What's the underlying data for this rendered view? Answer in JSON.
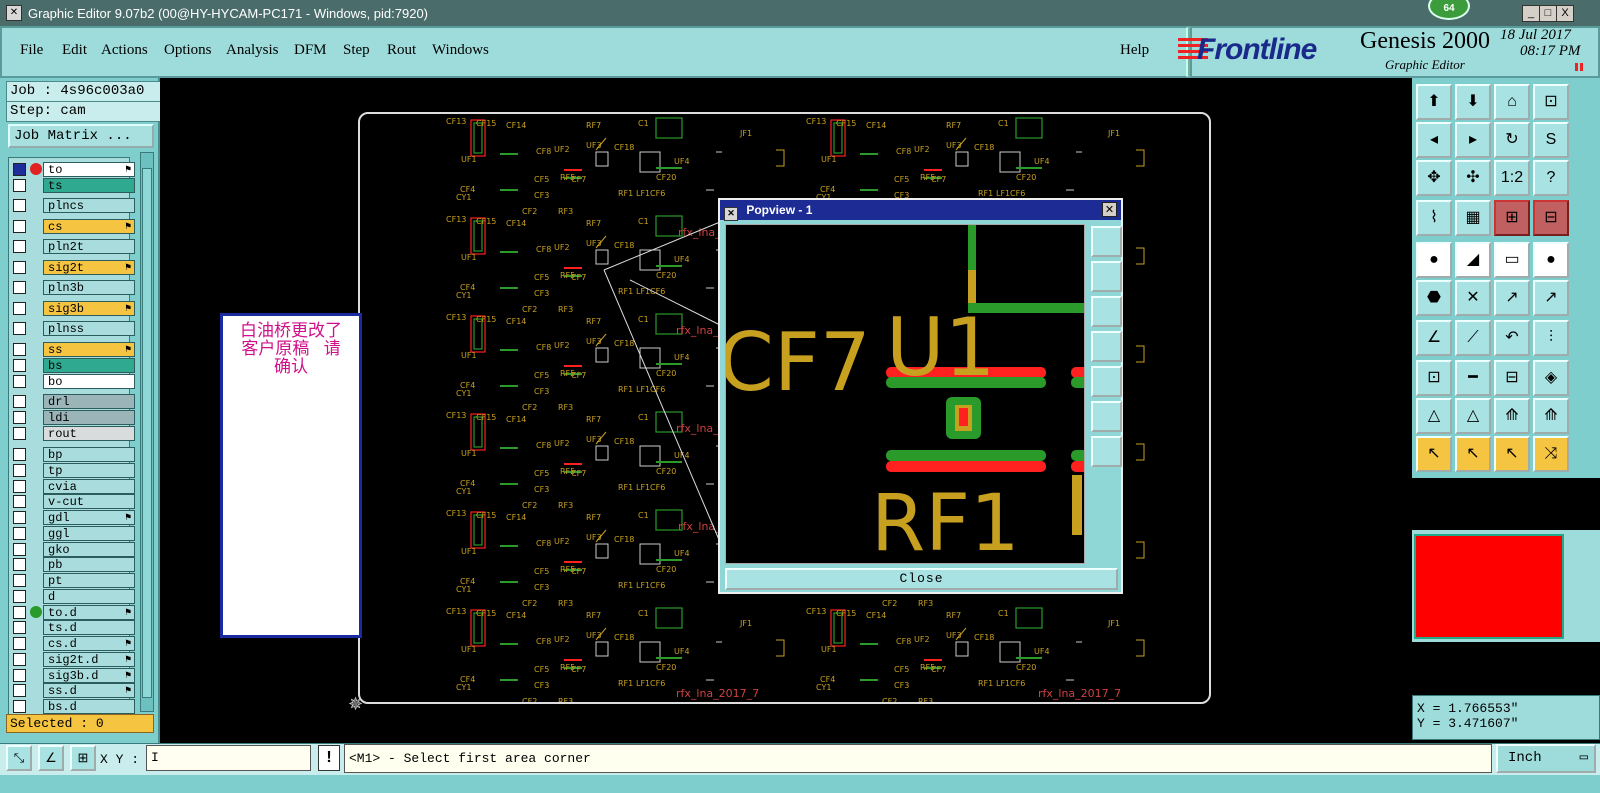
{
  "window": {
    "title": "Graphic Editor 9.07b2 (00@HY-HYCAM-PC171 - Windows, pid:7920)",
    "badge": "64",
    "controls": [
      "_",
      "□",
      "X"
    ]
  },
  "menu": {
    "items": [
      "File",
      "Edit",
      "Actions",
      "Options",
      "Analysis",
      "DFM",
      "Step",
      "Rout",
      "Windows"
    ],
    "help": "Help"
  },
  "brand": {
    "logo": "Frontline",
    "product": "Genesis 2000",
    "subtitle": "Graphic Editor",
    "date": "18 Jul 2017",
    "time": "08:17 PM"
  },
  "job": {
    "job_label": "Job : 4s96c003a0",
    "step_label": "Step: cam",
    "matrix_button": "Job Matrix ..."
  },
  "layers": [
    {
      "name": "to",
      "bg": "#ffffff",
      "checked": true,
      "dot": "#e22222",
      "flag": "⚑"
    },
    {
      "name": "ts",
      "bg": "#2fa98f",
      "checked": false,
      "dot": "",
      "flag": ""
    },
    {
      "name": "plncs",
      "bg": "#a9dcdc",
      "checked": false,
      "dot": "",
      "flag": ""
    },
    {
      "name": "cs",
      "bg": "#f5c542",
      "checked": false,
      "dot": "",
      "flag": "⚑"
    },
    {
      "name": "pln2t",
      "bg": "#a9dcdc",
      "checked": false,
      "dot": "",
      "flag": ""
    },
    {
      "name": "sig2t",
      "bg": "#f5c542",
      "checked": false,
      "dot": "",
      "flag": "⚑"
    },
    {
      "name": "pln3b",
      "bg": "#a9dcdc",
      "checked": false,
      "dot": "",
      "flag": ""
    },
    {
      "name": "sig3b",
      "bg": "#f5c542",
      "checked": false,
      "dot": "",
      "flag": "⚑"
    },
    {
      "name": "plnss",
      "bg": "#a9dcdc",
      "checked": false,
      "dot": "",
      "flag": ""
    },
    {
      "name": "ss",
      "bg": "#f5c542",
      "checked": false,
      "dot": "",
      "flag": "⚑"
    },
    {
      "name": "bs",
      "bg": "#2fa98f",
      "checked": false,
      "dot": "",
      "flag": ""
    },
    {
      "name": "bo",
      "bg": "#ffffff",
      "checked": false,
      "dot": "",
      "flag": ""
    },
    {
      "name": "drl",
      "bg": "#9ab4b8",
      "checked": false,
      "dot": "",
      "flag": ""
    },
    {
      "name": "ldi",
      "bg": "#9ab4b8",
      "checked": false,
      "dot": "",
      "flag": ""
    },
    {
      "name": "rout",
      "bg": "#d8dcdc",
      "checked": false,
      "dot": "",
      "flag": ""
    },
    {
      "name": "bp",
      "bg": "#a9dcdc",
      "checked": false,
      "dot": "",
      "flag": ""
    },
    {
      "name": "tp",
      "bg": "#a9dcdc",
      "checked": false,
      "dot": "",
      "flag": ""
    },
    {
      "name": "cvia",
      "bg": "#a9dcdc",
      "checked": false,
      "dot": "",
      "flag": ""
    },
    {
      "name": "v-cut",
      "bg": "#a9dcdc",
      "checked": false,
      "dot": "",
      "flag": ""
    },
    {
      "name": "gdl",
      "bg": "#a9dcdc",
      "checked": false,
      "dot": "",
      "flag": "⚑"
    },
    {
      "name": "ggl",
      "bg": "#a9dcdc",
      "checked": false,
      "dot": "",
      "flag": ""
    },
    {
      "name": "gko",
      "bg": "#a9dcdc",
      "checked": false,
      "dot": "",
      "flag": ""
    },
    {
      "name": "pb",
      "bg": "#a9dcdc",
      "checked": false,
      "dot": "",
      "flag": ""
    },
    {
      "name": "pt",
      "bg": "#a9dcdc",
      "checked": false,
      "dot": "",
      "flag": ""
    },
    {
      "name": "d",
      "bg": "#a9dcdc",
      "checked": false,
      "dot": "",
      "flag": ""
    },
    {
      "name": "to.d",
      "bg": "#a9dcdc",
      "checked": false,
      "dot": "#2a9a2a",
      "flag": "⚑"
    },
    {
      "name": "ts.d",
      "bg": "#a9dcdc",
      "checked": false,
      "dot": "",
      "flag": ""
    },
    {
      "name": "cs.d",
      "bg": "#a9dcdc",
      "checked": false,
      "dot": "",
      "flag": "⚑"
    },
    {
      "name": "sig2t.d",
      "bg": "#a9dcdc",
      "checked": false,
      "dot": "",
      "flag": "⚑"
    },
    {
      "name": "sig3b.d",
      "bg": "#a9dcdc",
      "checked": false,
      "dot": "",
      "flag": "⚑"
    },
    {
      "name": "ss.d",
      "bg": "#a9dcdc",
      "checked": false,
      "dot": "",
      "flag": "⚑"
    },
    {
      "name": "bs.d",
      "bg": "#a9dcdc",
      "checked": false,
      "dot": "",
      "flag": ""
    }
  ],
  "selected_label": "Selected : 0",
  "note": {
    "line1": "白油桥更改了",
    "line2": "客户原稿   请",
    "line3": "确认"
  },
  "board": {
    "silk_labels": [
      "CF13",
      "CF15",
      "CF14",
      "RF7",
      "C1",
      "JF1",
      "UF1",
      "CF8",
      "UF2",
      "UF3",
      "CF5",
      "RF5",
      "CF7",
      "RF1",
      "LF1",
      "CF6",
      "CF3",
      "RF3",
      "CF4",
      "CY1",
      "CF2",
      "CF20",
      "UF4",
      "CF16",
      "CF18"
    ],
    "panel_text": "rfx_lna_2017_7"
  },
  "popview": {
    "title": "Popview - 1",
    "close_label": "Close",
    "labels": {
      "cf7": "CF7",
      "u1": "U1",
      "rf1": "RF1"
    }
  },
  "coords": {
    "x": "X = 1.766553\"",
    "y": "Y = 3.471607\""
  },
  "bottom": {
    "xy_label": "X Y :",
    "xy_value": "I",
    "alert": "!",
    "prompt": "<M1> - Select first area corner",
    "unit": "Inch"
  },
  "colors": {
    "accent": "#9edcdc",
    "copper": "#c8a020",
    "silk": "#c8a020",
    "green_layer": "#2a9a2a",
    "red_layer": "#ff2020",
    "note_text": "#d0108a",
    "title_blue": "#1c2c94"
  }
}
